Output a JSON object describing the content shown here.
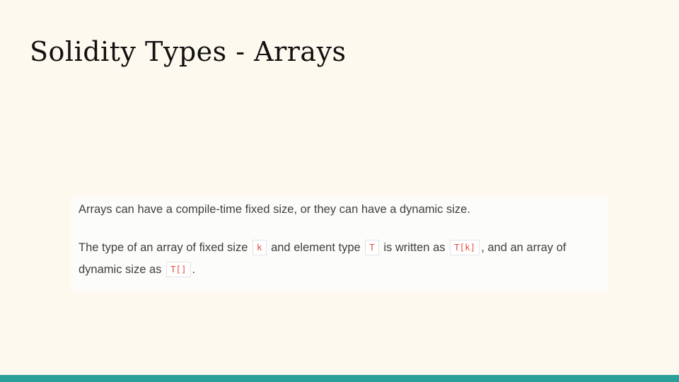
{
  "slide": {
    "title": "Solidity Types - Arrays"
  },
  "doc": {
    "para1": "Arrays can have a compile-time fixed size, or they can have a dynamic size.",
    "para2": {
      "t1": "The type of an array of fixed size ",
      "c1": "k",
      "t2": " and element type ",
      "c2": "T",
      "t3": " is written as ",
      "c3": "T[k]",
      "t4": ", and an array of"
    },
    "para3": {
      "t1": "dynamic size as ",
      "c1": "T[]",
      "t2": "."
    }
  },
  "colors": {
    "background": "#fef9ef",
    "accent_bar": "#2aa198",
    "code_text": "#e74c3c",
    "body_text": "#404040"
  }
}
